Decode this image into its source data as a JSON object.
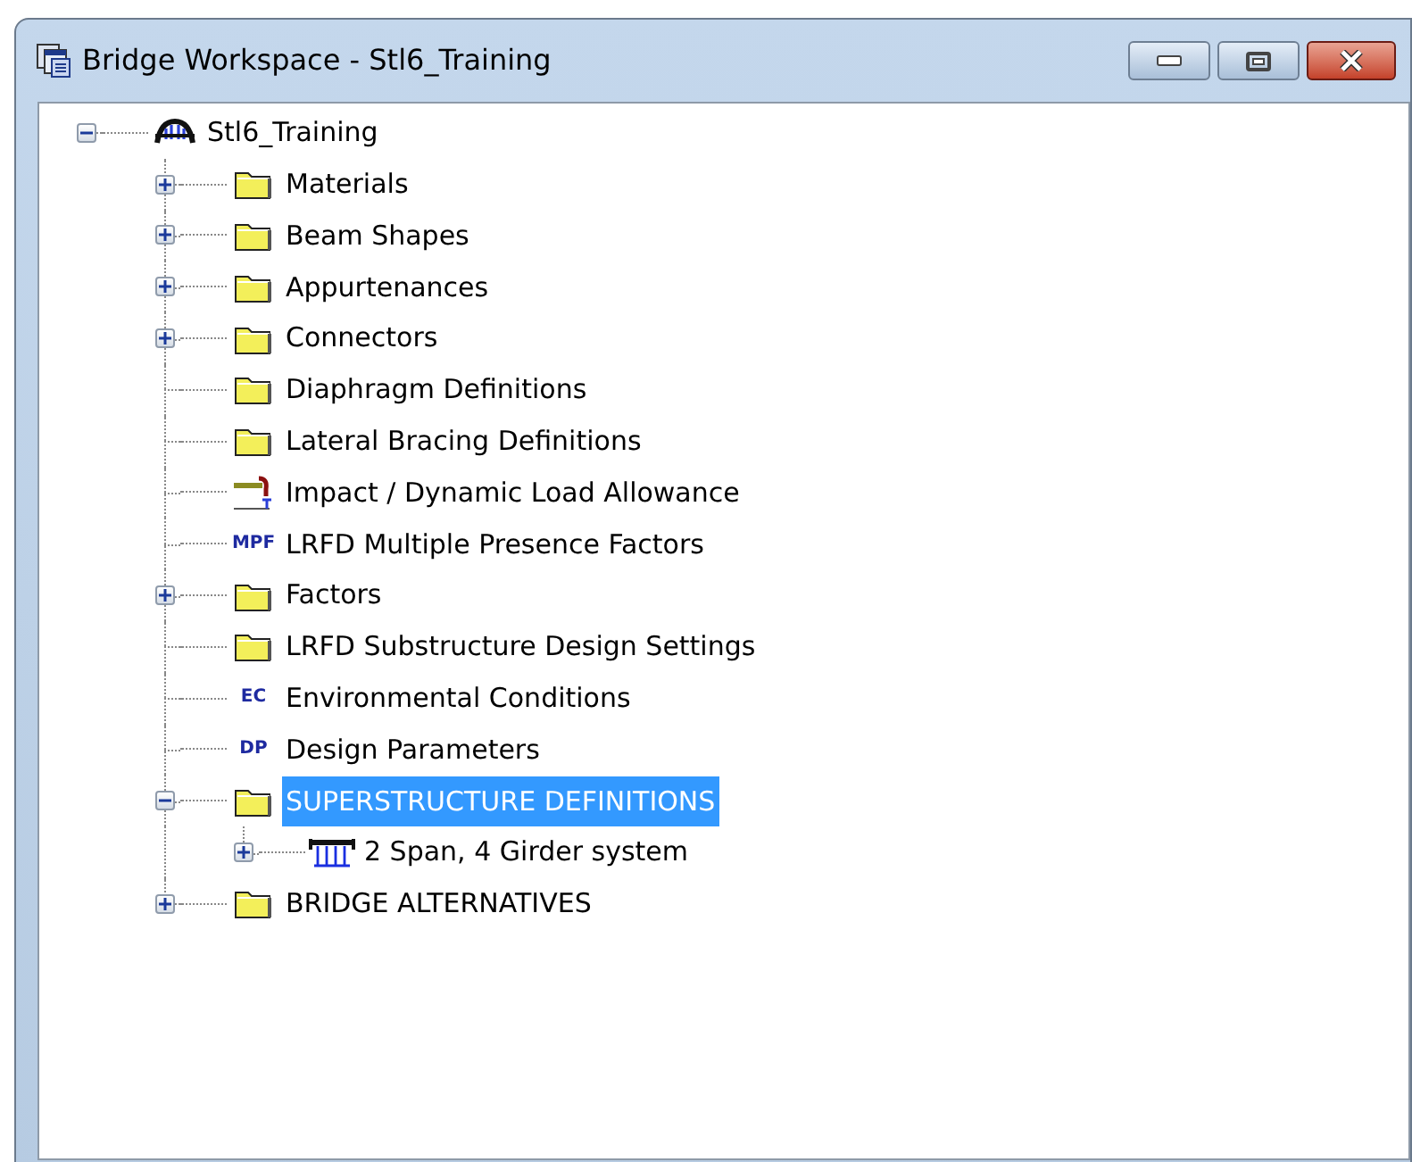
{
  "window": {
    "title": "Bridge Workspace - Stl6_Training"
  },
  "tree": [
    {
      "label": "Stl6_Training",
      "kind": "bridge",
      "expandable": true,
      "expanded": true,
      "selected": false,
      "children": [
        {
          "label": "Materials",
          "kind": "folder",
          "expandable": true,
          "expanded": false,
          "selected": false
        },
        {
          "label": "Beam Shapes",
          "kind": "folder",
          "expandable": true,
          "expanded": false,
          "selected": false
        },
        {
          "label": "Appurtenances",
          "kind": "folder",
          "expandable": true,
          "expanded": false,
          "selected": false
        },
        {
          "label": "Connectors",
          "kind": "folder",
          "expandable": true,
          "expanded": false,
          "selected": false
        },
        {
          "label": "Diaphragm Definitions",
          "kind": "folder",
          "expandable": false,
          "selected": false
        },
        {
          "label": "Lateral Bracing Definitions",
          "kind": "folder",
          "expandable": false,
          "selected": false
        },
        {
          "label": "Impact / Dynamic Load Allowance",
          "kind": "impact",
          "expandable": false,
          "selected": false
        },
        {
          "label": "LRFD Multiple Presence Factors",
          "kind": "letters",
          "icon_text": "MPF",
          "expandable": false,
          "selected": false
        },
        {
          "label": "Factors",
          "kind": "folder",
          "expandable": true,
          "expanded": false,
          "selected": false
        },
        {
          "label": "LRFD Substructure Design Settings",
          "kind": "folder",
          "expandable": false,
          "selected": false
        },
        {
          "label": "Environmental Conditions",
          "kind": "letters",
          "icon_text": "EC",
          "expandable": false,
          "selected": false
        },
        {
          "label": "Design Parameters",
          "kind": "letters",
          "icon_text": "DP",
          "expandable": false,
          "selected": false
        },
        {
          "label": "SUPERSTRUCTURE DEFINITIONS",
          "kind": "folder",
          "expandable": true,
          "expanded": true,
          "selected": true,
          "children": [
            {
              "label": "2 Span, 4 Girder system",
              "kind": "girder",
              "expandable": true,
              "expanded": false,
              "selected": false
            }
          ]
        },
        {
          "label": "BRIDGE ALTERNATIVES",
          "kind": "folder",
          "expandable": true,
          "expanded": false,
          "selected": false
        }
      ]
    }
  ]
}
